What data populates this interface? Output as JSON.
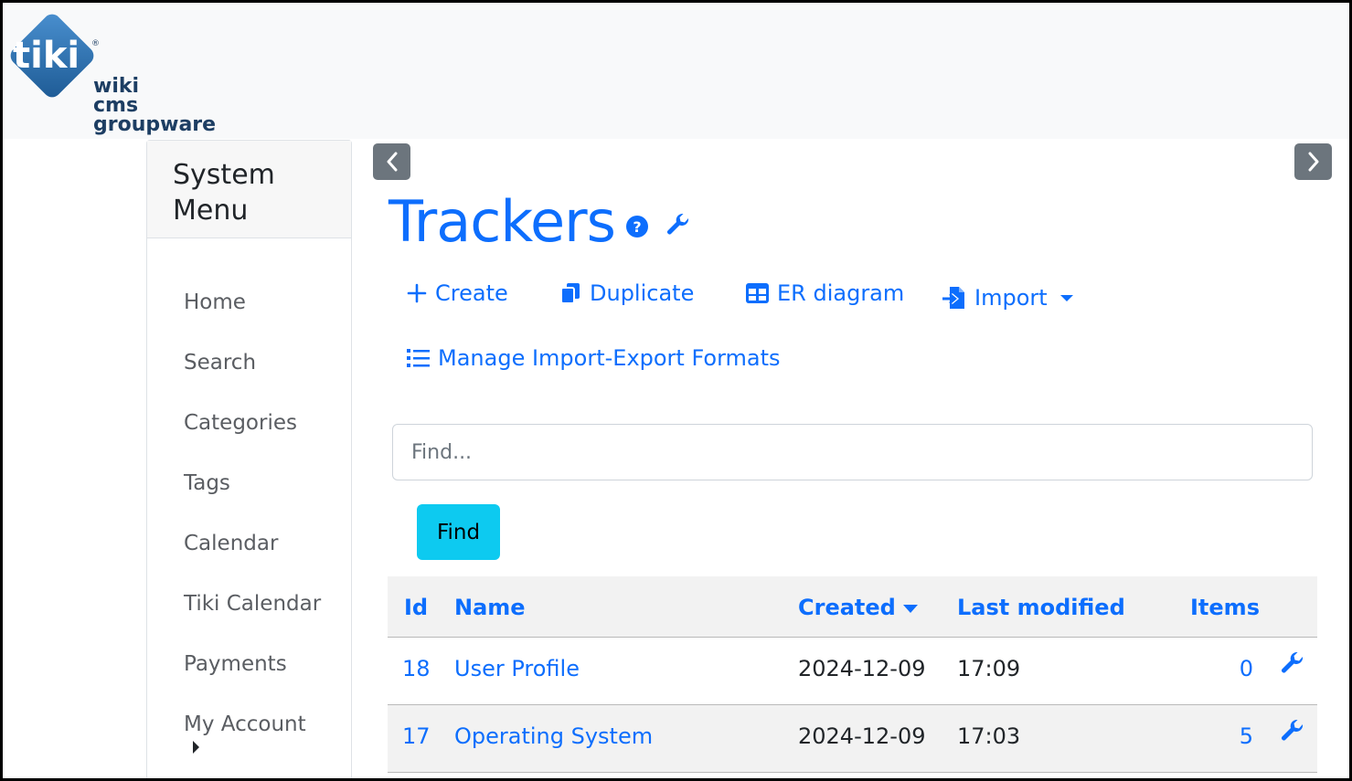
{
  "logo": {
    "badge_text": "tiki",
    "line1": "wiki",
    "line2": "cms",
    "line3": "groupware",
    "registered": "®"
  },
  "sidebar": {
    "title": "System Menu",
    "items": [
      {
        "label": "Home"
      },
      {
        "label": "Search"
      },
      {
        "label": "Categories"
      },
      {
        "label": "Tags"
      },
      {
        "label": "Calendar"
      },
      {
        "label": "Tiki Calendar"
      },
      {
        "label": "Payments"
      },
      {
        "label": "My Account"
      }
    ]
  },
  "page": {
    "title": "Trackers"
  },
  "actions": {
    "create": "Create",
    "duplicate": "Duplicate",
    "er_diagram": "ER diagram",
    "import": "Import",
    "manage_formats": "Manage Import-Export Formats"
  },
  "search": {
    "placeholder": "Find...",
    "button": "Find"
  },
  "table": {
    "columns": {
      "id": "Id",
      "name": "Name",
      "created": "Created",
      "last_modified": "Last modified",
      "items": "Items"
    },
    "rows": [
      {
        "id": "18",
        "name": "User Profile",
        "created": "2024-12-09",
        "last_modified": "17:09",
        "items": "0"
      },
      {
        "id": "17",
        "name": "Operating System",
        "created": "2024-12-09",
        "last_modified": "17:03",
        "items": "5"
      }
    ]
  },
  "colors": {
    "primary": "#0d6efd",
    "info": "#0dcaf0",
    "secondary": "#6c757d",
    "logo_blue": "#1d5a94"
  },
  "icons": {
    "help": "question-circle-icon",
    "admin": "wrench-icon",
    "create": "plus-icon",
    "duplicate": "copy-icon",
    "er_diagram": "table-icon",
    "import": "file-import-icon",
    "manage": "list-icon",
    "nav_prev": "chevron-left-icon",
    "nav_next": "chevron-right-icon"
  }
}
